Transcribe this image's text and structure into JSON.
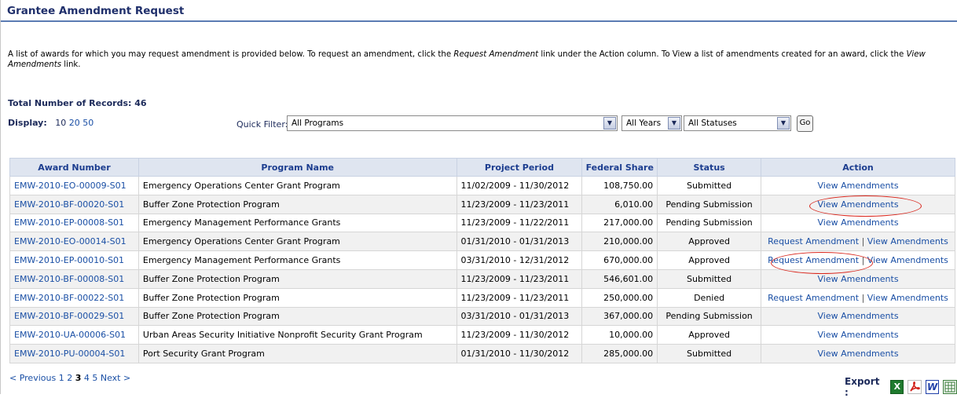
{
  "page": {
    "title": "Grantee Amendment Request",
    "intro": {
      "part1": "A list of awards for which you may request amendment is provided below. To request an amendment, click the ",
      "link1": "Request Amendment",
      "part2": " link under the Action column. To View a list of amendments created for an award, click the ",
      "link2": "View Amendments",
      "part3": " link."
    },
    "total_records": "Total Number of Records: 46"
  },
  "display": {
    "label": "Display:",
    "options": [
      "10",
      "20",
      "50"
    ]
  },
  "filter": {
    "label": "Quick Filter:",
    "program": "All Programs",
    "year": "All Years",
    "status": "All Statuses",
    "go": "Go"
  },
  "table": {
    "headers": [
      "Award Number",
      "Program Name",
      "Project Period",
      "Federal Share",
      "Status",
      "Action"
    ],
    "rows": [
      {
        "award": "EMW-2010-EO-00009-S01",
        "program": "Emergency Operations Center Grant Program",
        "period": "11/02/2009 - 11/30/2012",
        "share": "108,750.00",
        "status": "Submitted",
        "request": "",
        "view": "View Amendments"
      },
      {
        "award": "EMW-2010-BF-00020-S01",
        "program": "Buffer Zone Protection Program",
        "period": "11/23/2009 - 11/23/2011",
        "share": "6,010.00",
        "status": "Pending Submission",
        "request": "",
        "view": "View Amendments"
      },
      {
        "award": "EMW-2010-EP-00008-S01",
        "program": "Emergency Management Performance Grants",
        "period": "11/23/2009 - 11/22/2011",
        "share": "217,000.00",
        "status": "Pending Submission",
        "request": "",
        "view": "View Amendments"
      },
      {
        "award": "EMW-2010-EO-00014-S01",
        "program": "Emergency Operations Center Grant Program",
        "period": "01/31/2010 - 01/31/2013",
        "share": "210,000.00",
        "status": "Approved",
        "request": "Request Amendment",
        "view": "View Amendments"
      },
      {
        "award": "EMW-2010-EP-00010-S01",
        "program": "Emergency Management Performance Grants",
        "period": "03/31/2010 - 12/31/2012",
        "share": "670,000.00",
        "status": "Approved",
        "request": "Request Amendment",
        "view": "View Amendments"
      },
      {
        "award": "EMW-2010-BF-00008-S01",
        "program": "Buffer Zone Protection Program",
        "period": "11/23/2009 - 11/23/2011",
        "share": "546,601.00",
        "status": "Submitted",
        "request": "",
        "view": "View Amendments"
      },
      {
        "award": "EMW-2010-BF-00022-S01",
        "program": "Buffer Zone Protection Program",
        "period": "11/23/2009 - 11/23/2011",
        "share": "250,000.00",
        "status": "Denied",
        "request": "Request Amendment",
        "view": "View Amendments"
      },
      {
        "award": "EMW-2010-BF-00029-S01",
        "program": "Buffer Zone Protection Program",
        "period": "03/31/2010 - 01/31/2013",
        "share": "367,000.00",
        "status": "Pending Submission",
        "request": "",
        "view": "View Amendments"
      },
      {
        "award": "EMW-2010-UA-00006-S01",
        "program": "Urban Areas Security Initiative Nonprofit Security Grant Program",
        "period": "11/23/2009 - 11/30/2012",
        "share": "10,000.00",
        "status": "Approved",
        "request": "",
        "view": "View Amendments"
      },
      {
        "award": "EMW-2010-PU-00004-S01",
        "program": "Port Security Grant Program",
        "period": "01/31/2010 - 11/30/2012",
        "share": "285,000.00",
        "status": "Submitted",
        "request": "",
        "view": "View Amendments"
      }
    ]
  },
  "pagination": {
    "previous": "< Previous",
    "pages": [
      "1",
      "2",
      "3",
      "4",
      "5"
    ],
    "current": "3",
    "next": "Next >"
  },
  "export": {
    "label": "Export :",
    "icons": [
      "excel-icon",
      "pdf-icon",
      "word-icon",
      "csv-icon"
    ]
  },
  "colors": {
    "title": "#1f2f6b",
    "link": "#1a4fa5",
    "header_bg": "#dfe5f0",
    "annotation_circle": "#d9261c"
  }
}
